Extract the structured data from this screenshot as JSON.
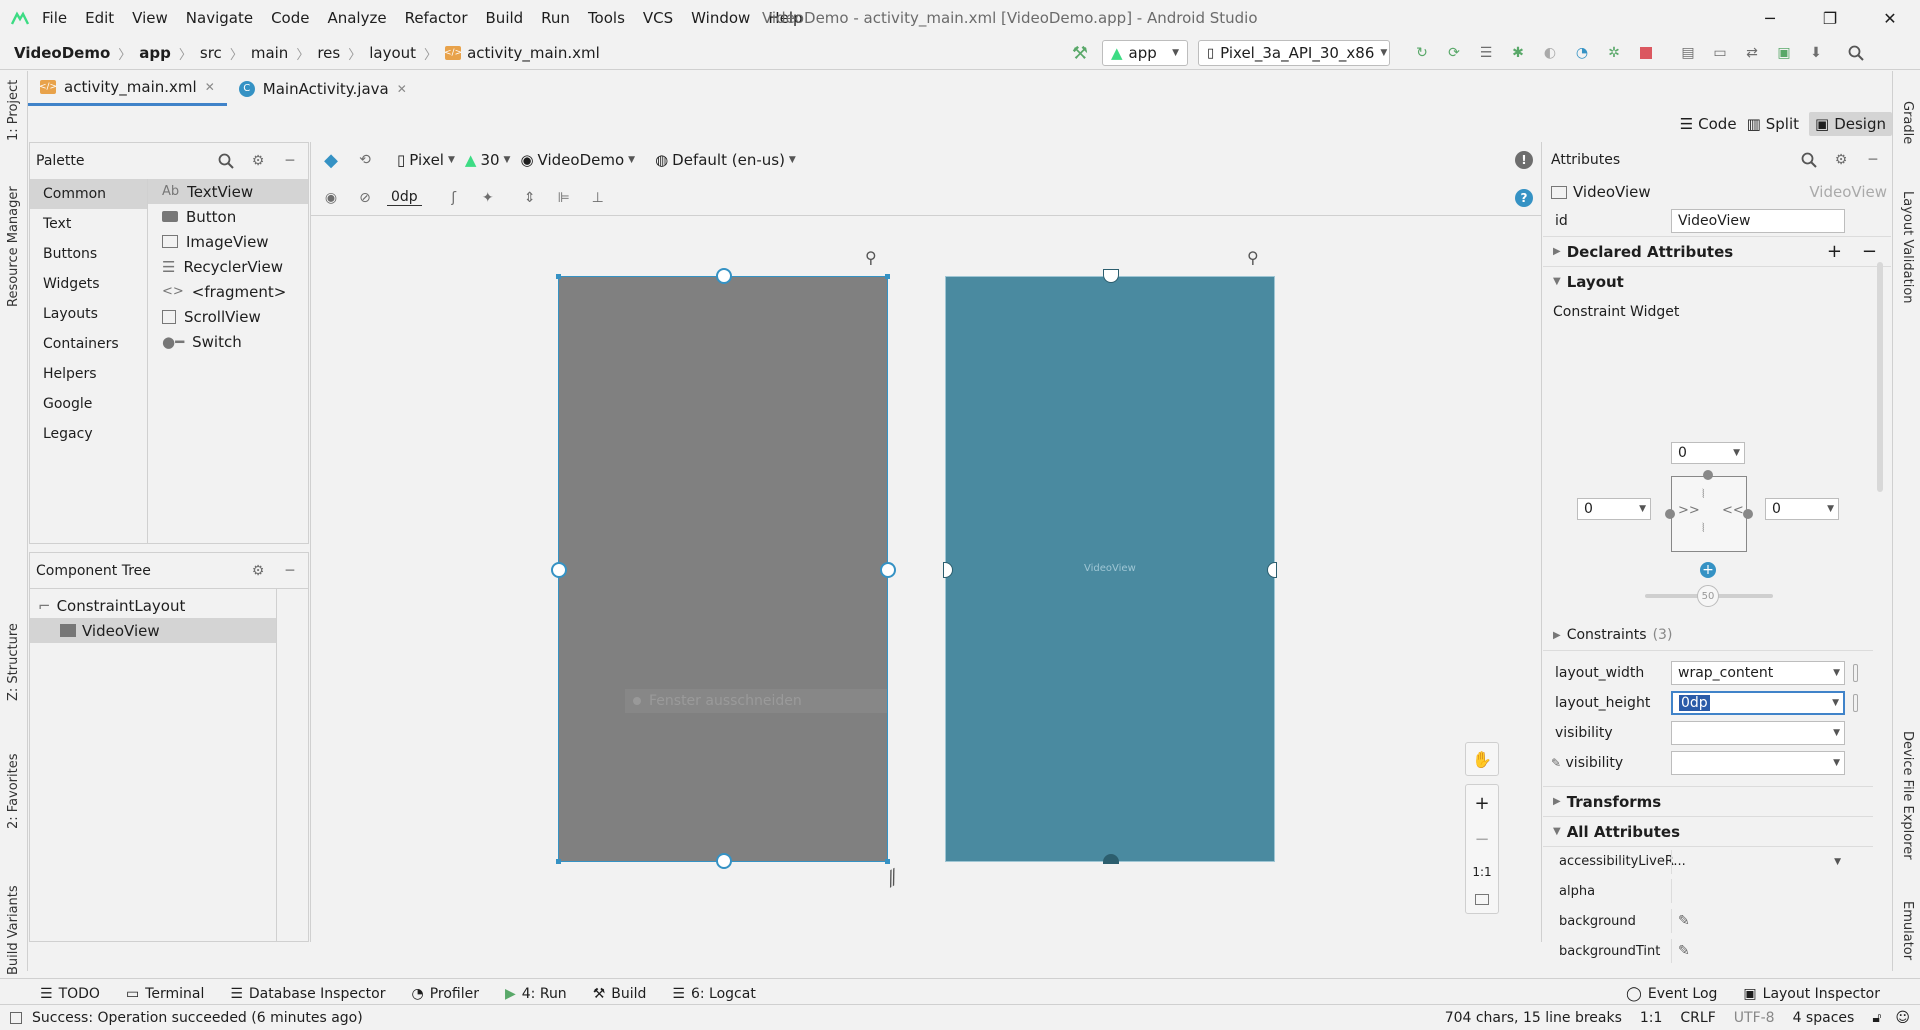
{
  "app": {
    "logo_icon": "android-studio-icon"
  },
  "menu": [
    "File",
    "Edit",
    "View",
    "Navigate",
    "Code",
    "Analyze",
    "Refactor",
    "Build",
    "Run",
    "Tools",
    "VCS",
    "Window",
    "Help"
  ],
  "window_title": "VideoDemo - activity_main.xml [VideoDemo.app] - Android Studio",
  "window_controls": {
    "minimize": "─",
    "maximize": "❐",
    "close": "✕"
  },
  "breadcrumb": {
    "project": "VideoDemo",
    "module": "app",
    "p1": "src",
    "p2": "main",
    "p3": "res",
    "p4": "layout",
    "file": "activity_main.xml"
  },
  "run_config": "app",
  "device": "Pixel_3a_API_30_x86",
  "tabs": [
    {
      "label": "activity_main.xml",
      "icon": "xml-file-icon"
    },
    {
      "label": "MainActivity.java",
      "icon": "java-class-icon"
    }
  ],
  "view_modes": {
    "code": "Code",
    "split": "Split",
    "design": "Design"
  },
  "left_tool_windows": {
    "project": "1: Project",
    "resource_manager": "Resource Manager",
    "structure": "Z: Structure",
    "favorites": "2: Favorites",
    "build_variants": "Build Variants"
  },
  "right_tool_windows": {
    "gradle": "Gradle",
    "layout_validation": "Layout Validation",
    "device_file_explorer": "Device File Explorer",
    "emulator": "Emulator"
  },
  "palette": {
    "title": "Palette",
    "categories": [
      "Common",
      "Text",
      "Buttons",
      "Widgets",
      "Layouts",
      "Containers",
      "Helpers",
      "Google",
      "Legacy"
    ],
    "items": [
      {
        "label": "TextView",
        "icon": "Ab"
      },
      {
        "label": "Button",
        "icon": "button-icon"
      },
      {
        "label": "ImageView",
        "icon": "image-icon"
      },
      {
        "label": "RecyclerView",
        "icon": "list-icon"
      },
      {
        "label": "<fragment>",
        "icon": "<>"
      },
      {
        "label": "ScrollView",
        "icon": "scroll-icon"
      },
      {
        "label": "Switch",
        "icon": "switch-icon"
      }
    ]
  },
  "component_tree": {
    "title": "Component Tree",
    "root": "ConstraintLayout",
    "child": "VideoView"
  },
  "design_toolbar": {
    "device": "Pixel",
    "api": "30",
    "theme": "VideoDemo",
    "locale": "Default (en-us)",
    "margin": "0dp"
  },
  "canvas": {
    "overlay_text": "Fenster ausschneiden",
    "blueprint_label": "VideoView",
    "design_color": "#808080",
    "blueprint_color": "#4a8aa0"
  },
  "zoom": {
    "plus": "+",
    "minus": "−",
    "one_to_one": "1:1"
  },
  "attributes": {
    "title": "Attributes",
    "component": "VideoView",
    "component_type": "VideoView",
    "id_label": "id",
    "id_value": "VideoView",
    "declared": "Declared Attributes",
    "layout": "Layout",
    "constraint_widget": "Constraint Widget",
    "margin_top": "0",
    "margin_left": "0",
    "margin_right": "0",
    "bias": "50",
    "constraints_label": "Constraints",
    "constraints_count": "(3)",
    "layout_width_label": "layout_width",
    "layout_width": "wrap_content",
    "layout_height_label": "layout_height",
    "layout_height": "0dp",
    "visibility_label": "visibility",
    "visibility_tool_label": "visibility",
    "transforms": "Transforms",
    "all_attributes": "All Attributes",
    "all": [
      {
        "k": "accessibilityLiveR..."
      },
      {
        "k": "alpha"
      },
      {
        "k": "background"
      },
      {
        "k": "backgroundTint"
      }
    ]
  },
  "bottom_tools": {
    "todo": "TODO",
    "terminal": "Terminal",
    "db": "Database Inspector",
    "profiler": "Profiler",
    "run": "4: Run",
    "build": "Build",
    "logcat": "6: Logcat",
    "event_log": "Event Log",
    "layout_inspector": "Layout Inspector"
  },
  "status": {
    "message": "Success: Operation succeeded (6 minutes ago)",
    "chars": "704 chars, 15 line breaks",
    "pos": "1:1",
    "eol": "CRLF",
    "enc": "UTF-8",
    "indent": "4 spaces"
  },
  "colors": {
    "accent": "#4083c9",
    "android_green": "#3ddc84",
    "run_green": "#59a869",
    "stop_red": "#db5860"
  }
}
